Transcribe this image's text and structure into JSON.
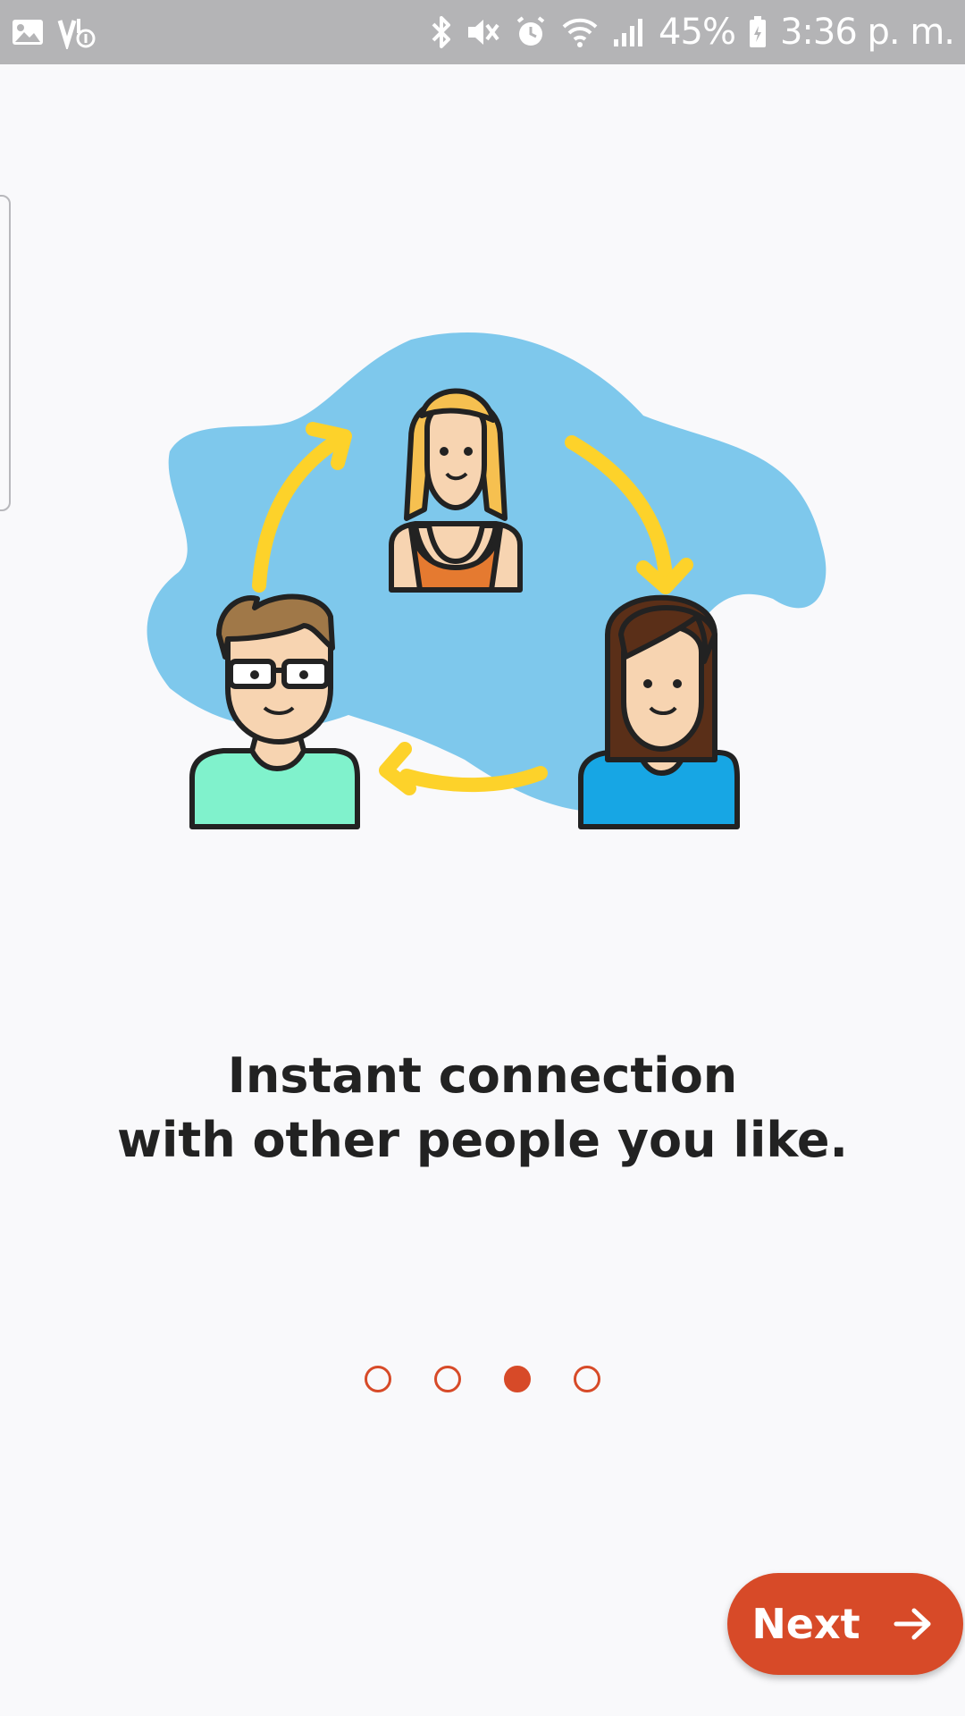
{
  "status_bar": {
    "battery": "45%",
    "time": "3:36 p. m.",
    "left_icons": [
      "image-icon",
      "volte-icon"
    ],
    "right_icons": [
      "bluetooth-icon",
      "mute-icon",
      "alarm-icon",
      "wifi-icon",
      "signal-icon",
      "battery-icon"
    ]
  },
  "onboarding": {
    "headline_line1": "Instant connection",
    "headline_line2": "with other people you like.",
    "page_count": 4,
    "active_page": 3,
    "next_label": "Next"
  },
  "colors": {
    "accent": "#d74a28",
    "status_bar": "#b4b4b6",
    "background": "#f9f9fb",
    "blob": "#7ec8ec",
    "arrows": "#fdd22a"
  }
}
